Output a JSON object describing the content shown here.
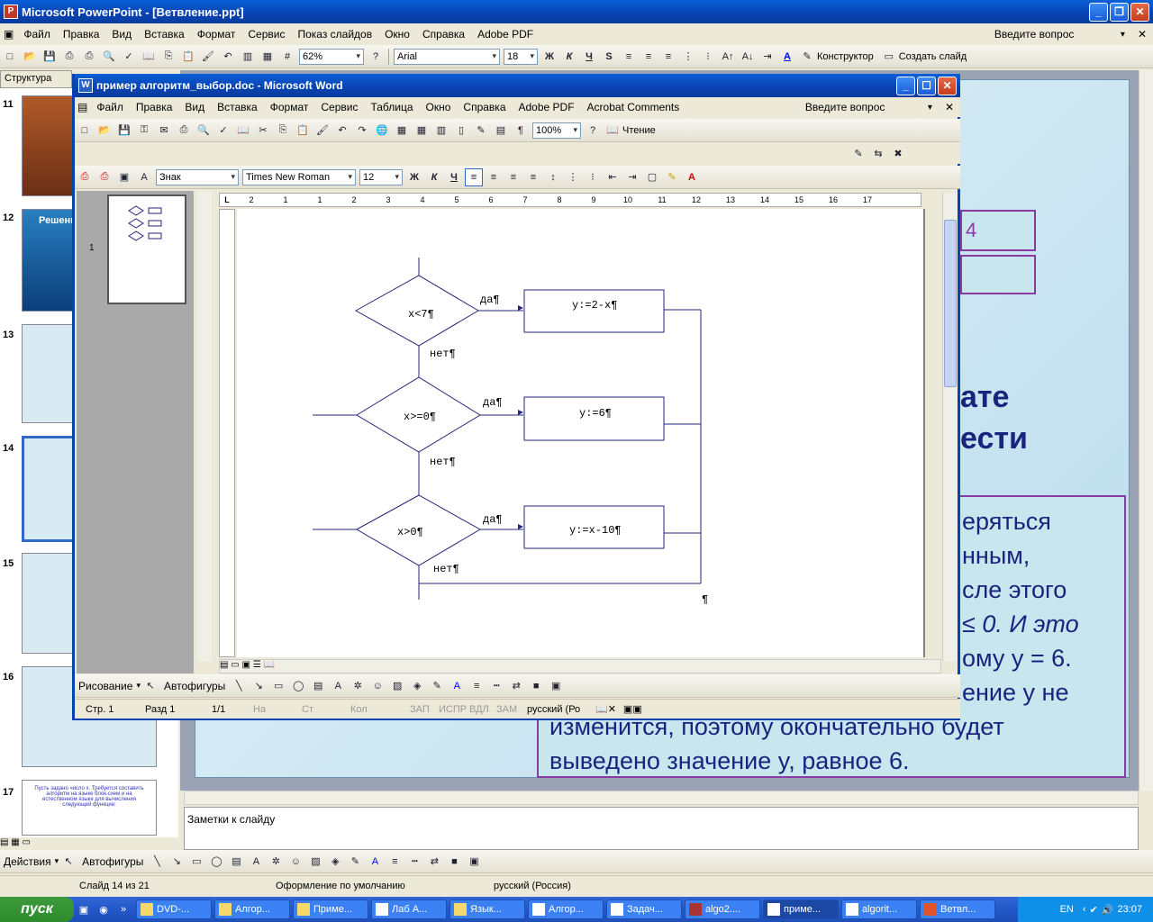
{
  "ppt": {
    "title": "Microsoft PowerPoint - [Ветвление.ppt]",
    "menu": [
      "Файл",
      "Правка",
      "Вид",
      "Вставка",
      "Формат",
      "Сервис",
      "Показ слайдов",
      "Окно",
      "Справка",
      "Adobe PDF"
    ],
    "ask_placeholder": "Введите вопрос",
    "font": "Arial",
    "font_size": "18",
    "zoom": "62%",
    "konstruktor": "Конструктор",
    "create_slide": "Создать слайд",
    "structure_tab": "Структура",
    "slide_numbers": [
      "11",
      "12",
      "13",
      "14",
      "15",
      "16",
      "17"
    ],
    "thumb12_title": "Решени",
    "thumb17_text": "Пусть задано число x. Требуется составить алгоритм на языке блок-схем и на естественном языке для вычисления следующей функции:",
    "slide_text_lines": [
      "ате",
      "ести"
    ],
    "slide_box_lines": [
      "еряться",
      "нным,",
      "сле этого",
      "≤ 0. И это",
      "ому  y = 6.",
      "ение y не",
      "изменится, поэтому окончательно будет",
      "выведено значение y, равное  6."
    ],
    "slide_purple_box": "4",
    "notes_label": "Заметки к слайду",
    "draw_actions": "Действия",
    "autoshapes": "Автофигуры",
    "status": {
      "slide": "Слайд 14 из 21",
      "design": "Оформление по умолчанию",
      "lang": "русский (Россия)"
    }
  },
  "word": {
    "title": "пример алгоритм_выбор.doc - Microsoft Word",
    "menu": [
      "Файл",
      "Правка",
      "Вид",
      "Вставка",
      "Формат",
      "Сервис",
      "Таблица",
      "Окно",
      "Справка",
      "Adobe PDF",
      "Acrobat Comments"
    ],
    "ask_placeholder": "Введите вопрос",
    "zoom": "100%",
    "reading": "Чтение",
    "style": "Знак",
    "font": "Times New Roman",
    "font_size": "12",
    "ruler": [
      "2",
      "1",
      "1",
      "2",
      "3",
      "4",
      "5",
      "6",
      "7",
      "8",
      "9",
      "10",
      "11",
      "12",
      "13",
      "14",
      "15",
      "16",
      "17"
    ],
    "page_thumb_number": "1",
    "draw": "Рисование",
    "autoshapes": "Автофигуры",
    "status": {
      "page": "Стр.  1",
      "section": "Разд  1",
      "pages": "1/1",
      "at": "На",
      "ln": "Ст",
      "col": "Кол",
      "rec": "ЗАП",
      "trk": "ИСПР",
      "ext": "ВДЛ",
      "ovr": "ЗАМ",
      "lang": "русский (Ро"
    }
  },
  "flowchart": {
    "conditions": [
      "x<7¶",
      "x>=0¶",
      "x>0¶"
    ],
    "actions": [
      "y:=2-x¶",
      "y:=6¶",
      "y:=x-10¶"
    ],
    "yes": "да¶",
    "no": "нет¶",
    "end_mark": "¶"
  },
  "taskbar": {
    "start": "пуск",
    "tasks": [
      "DVD-...",
      "Алгор...",
      "Приме...",
      "Лаб А...",
      "Язык...",
      "Алгор...",
      "Задач...",
      "algo2....",
      "приме...",
      "algorit...",
      "Ветвл..."
    ],
    "lang": "EN",
    "time": "23:07"
  }
}
